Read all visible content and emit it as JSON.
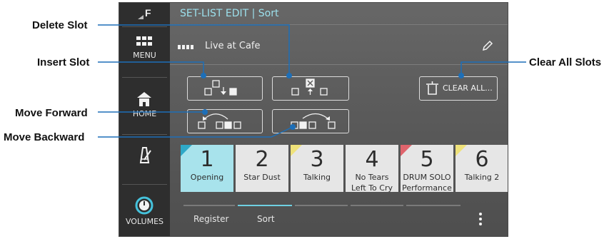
{
  "callouts": {
    "delete_slot": "Delete Slot",
    "insert_slot": "Insert Slot",
    "move_forward": "Move Forward",
    "move_backward": "Move Backward",
    "clear_all_slots": "Clear All Slots"
  },
  "header": {
    "title": "SET-LIST EDIT | Sort"
  },
  "set_list": {
    "name": "Live at Cafe",
    "icon": "set-list-icon",
    "edit_icon": "pencil-icon"
  },
  "sidebar": {
    "logo": "F",
    "menu_label": "MENU",
    "home_label": "HOME",
    "metronome_icon": "metronome-icon",
    "volumes_label": "VOLUMES"
  },
  "toolbar": {
    "clear_all_label": "CLEAR ALL..."
  },
  "slots": [
    {
      "number": "1",
      "name_line1": "Opening",
      "name_line2": "",
      "selected": true,
      "tag_color": "#2fa9c8"
    },
    {
      "number": "2",
      "name_line1": "Star Dust",
      "name_line2": "",
      "selected": false,
      "tag_color": ""
    },
    {
      "number": "3",
      "name_line1": "Talking",
      "name_line2": "",
      "selected": false,
      "tag_color": "#efe27a"
    },
    {
      "number": "4",
      "name_line1": "No Tears",
      "name_line2": "Left To Cry",
      "selected": false,
      "tag_color": ""
    },
    {
      "number": "5",
      "name_line1": "DRUM SOLO",
      "name_line2": "Performance",
      "selected": false,
      "tag_color": "#e0646c"
    },
    {
      "number": "6",
      "name_line1": "Talking 2",
      "name_line2": "",
      "selected": false,
      "tag_color": "#efe27a"
    }
  ],
  "tabs": [
    {
      "label": "Register",
      "active": false
    },
    {
      "label": "Sort",
      "active": true
    }
  ],
  "colors": {
    "accent": "#6fd0e2",
    "callout_line": "#1d6fb8",
    "screen_bg": "#5e5e5e",
    "sidebar_bg": "#2e2e2e"
  }
}
